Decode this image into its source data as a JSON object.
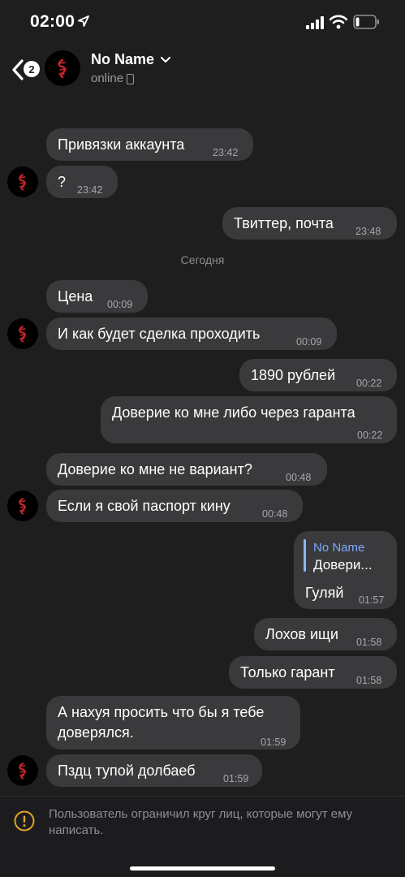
{
  "status_bar": {
    "time": "02:00"
  },
  "header": {
    "unread_count": "2",
    "title": "No Name",
    "status": "online"
  },
  "messages": [
    {
      "side": "in",
      "text": "Привязки аккаунта",
      "time": "23:42"
    },
    {
      "side": "in",
      "text": "?",
      "time": "23:42"
    },
    {
      "side": "out",
      "text": "Твиттер, почта",
      "time": "23:48"
    },
    {
      "date_separator": "Сегодня"
    },
    {
      "side": "in",
      "text": "Цена",
      "time": "00:09"
    },
    {
      "side": "in",
      "text": "И как будет сделка проходить",
      "time": "00:09"
    },
    {
      "side": "out",
      "text": "1890 рублей",
      "time": "00:22"
    },
    {
      "side": "out",
      "text": "Доверие ко мне либо через гаранта",
      "time": "00:22"
    },
    {
      "side": "in",
      "text": "Доверие ко мне не вариант?",
      "time": "00:48"
    },
    {
      "side": "in",
      "text": "Если я свой паспорт кину",
      "time": "00:48"
    },
    {
      "side": "out",
      "reply_name": "No Name",
      "reply_text": "Довери...",
      "text": "Гуляй",
      "time": "01:57"
    },
    {
      "side": "out",
      "text": "Лохов ищи",
      "time": "01:58"
    },
    {
      "side": "out",
      "text": "Только гарант",
      "time": "01:58"
    },
    {
      "side": "in",
      "text_line1": "А нахуя просить что бы я тебе",
      "text_line2": "доверялся.",
      "time": "01:59"
    },
    {
      "side": "in",
      "text": "Пздц тупой долбаеб",
      "time": "01:59"
    }
  ],
  "restriction": {
    "text": "Пользователь ограничил круг лиц, которые могут ему написать."
  },
  "colors": {
    "bubble": "#3a3a3c",
    "background": "#1e1e1e",
    "reply_accent": "#7aa9ff"
  }
}
